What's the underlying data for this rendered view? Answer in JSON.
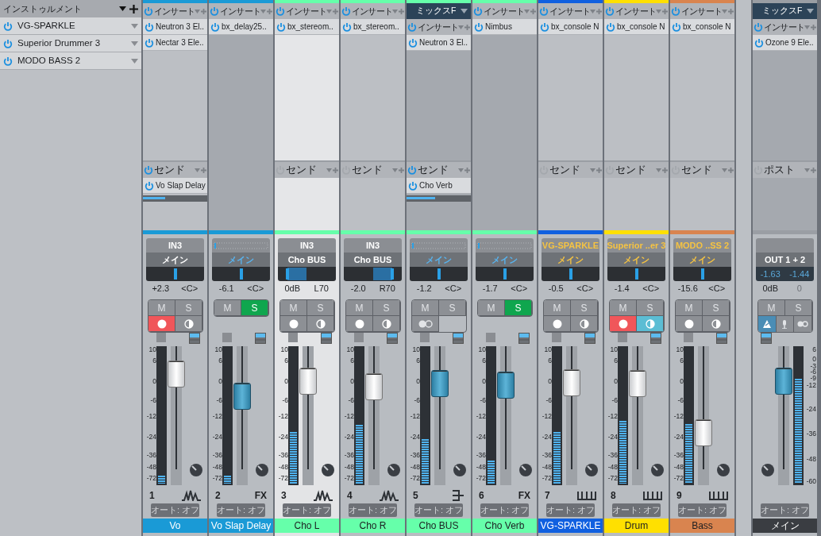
{
  "instruments": {
    "title": "インストゥルメント",
    "items": [
      {
        "name": "VG-SPARKLE",
        "on": true
      },
      {
        "name": "Superior Drummer 3",
        "on": true
      },
      {
        "name": "MODO BASS 2",
        "on": true
      }
    ]
  },
  "channels": [
    {
      "kind": "audio",
      "color": "#1a9ad6",
      "selected": false,
      "inserts": {
        "label": "インサート",
        "on": true,
        "items": [
          {
            "name": "Neutron 3 El..",
            "on": true
          },
          {
            "name": "Nectar 3 Ele..",
            "on": true
          }
        ]
      },
      "sends": {
        "label": "センド",
        "on": true,
        "items": [
          {
            "name": "Vo Slap Delay",
            "on": true,
            "level": 0.35
          }
        ]
      },
      "input": "IN3",
      "output": "メイン",
      "pan": {
        "level": 0.5
      },
      "volume": "+2.3",
      "pan_text": "<C>",
      "mute_label": "M",
      "solo_label": "S",
      "muted": false,
      "solo": false,
      "record": true,
      "monitor": false,
      "fader": {
        "level": 0.8
      },
      "meter": {
        "level": 0.06
      },
      "scale": [
        "10",
        "6",
        "0",
        "-6",
        "-12",
        "-24",
        "-36",
        "-48",
        "-72"
      ],
      "number": "1",
      "auto": "オート: オフ",
      "name": "Vo"
    },
    {
      "kind": "fx",
      "color": "#1a9ad6",
      "selected": false,
      "inserts": {
        "label": "インサート",
        "on": true,
        "items": [
          {
            "name": "bx_delay25..",
            "on": true
          }
        ]
      },
      "output": "メイン",
      "pan": {
        "level": 0.5
      },
      "volume": "-6.1",
      "pan_text": "<C>",
      "mute_label": "M",
      "solo_label": "S",
      "muted": false,
      "solo": true,
      "fader": {
        "level": 0.64
      },
      "meter": {
        "level": 0.06
      },
      "scale": [
        "10",
        "6",
        "0",
        "-6",
        "-12",
        "-24",
        "-36",
        "-48",
        "-72"
      ],
      "number": "2",
      "type_label": "FX",
      "auto": "オート: オフ",
      "name": "Vo Slap Delay"
    },
    {
      "kind": "audio",
      "color": "#66ffaa",
      "selected": true,
      "inserts": {
        "label": "インサート",
        "on": true,
        "items": [
          {
            "name": "bx_stereom..",
            "on": true
          }
        ]
      },
      "sends": {
        "label": "センド",
        "on": false
      },
      "input": "IN3",
      "output": "Cho BUS",
      "pan": {
        "level": 0.17
      },
      "volume": "0dB",
      "pan_text": "L70",
      "mute_label": "M",
      "solo_label": "S",
      "muted": false,
      "solo": false,
      "record": false,
      "monitor": false,
      "fader": {
        "level": 0.75
      },
      "meter": {
        "level": 0.38
      },
      "scale": [
        "10",
        "6",
        "0",
        "-6",
        "-12",
        "-24",
        "-36",
        "-48",
        "-72"
      ],
      "number": "3",
      "auto": "オート: オフ",
      "name": "Cho L"
    },
    {
      "kind": "audio",
      "color": "#66ffaa",
      "selected": false,
      "inserts": {
        "label": "インサート",
        "on": true,
        "items": [
          {
            "name": "bx_stereom..",
            "on": true
          }
        ]
      },
      "sends": {
        "label": "センド",
        "on": false
      },
      "input": "IN3",
      "output": "Cho BUS",
      "pan": {
        "level": 0.83
      },
      "volume": "-2.0",
      "pan_text": "R70",
      "mute_label": "M",
      "solo_label": "S",
      "muted": false,
      "solo": false,
      "record": false,
      "monitor": false,
      "fader": {
        "level": 0.71
      },
      "meter": {
        "level": 0.43
      },
      "scale": [
        "10",
        "6",
        "0",
        "-6",
        "-12",
        "-24",
        "-36",
        "-48",
        "-72"
      ],
      "number": "4",
      "auto": "オート: オフ",
      "name": "Cho R"
    },
    {
      "kind": "bus",
      "color": "#66ffaa",
      "selected": false,
      "header": "ミックスF",
      "inserts": {
        "label": "インサート",
        "on": true,
        "items": [
          {
            "name": "Neutron 3 El..",
            "on": true
          }
        ]
      },
      "sends": {
        "label": "センド",
        "on": true,
        "items": [
          {
            "name": "Cho Verb",
            "on": true,
            "level": 0.45
          }
        ]
      },
      "output": "メイン",
      "pan": {
        "level": 0.5
      },
      "volume": "-1.2",
      "pan_text": "<C>",
      "mute_label": "M",
      "solo_label": "S",
      "muted": false,
      "solo": false,
      "linked": false,
      "fader": {
        "level": 0.73
      },
      "meter": {
        "level": 0.33
      },
      "scale": [
        "10",
        "6",
        "0",
        "-6",
        "-12",
        "-24",
        "-36",
        "-48",
        "-72"
      ],
      "number": "5",
      "auto": "オート: オフ",
      "name": "Cho BUS"
    },
    {
      "kind": "fx",
      "color": "#66ffaa",
      "selected": false,
      "inserts": {
        "label": "インサート",
        "on": true,
        "items": [
          {
            "name": "Nimbus",
            "on": true
          }
        ]
      },
      "output": "メイン",
      "pan": {
        "level": 0.5
      },
      "volume": "-1.7",
      "pan_text": "<C>",
      "mute_label": "M",
      "solo_label": "S",
      "muted": false,
      "solo": true,
      "fader": {
        "level": 0.72
      },
      "meter": {
        "level": 0.17
      },
      "scale": [
        "10",
        "6",
        "0",
        "-6",
        "-12",
        "-24",
        "-36",
        "-48",
        "-72"
      ],
      "number": "6",
      "type_label": "FX",
      "auto": "オート: オフ",
      "name": "Cho Verb"
    },
    {
      "kind": "instrument",
      "color": "#1060e0",
      "selected": false,
      "inserts": {
        "label": "インサート",
        "on": true,
        "items": [
          {
            "name": "bx_console N",
            "on": true
          }
        ]
      },
      "sends": {
        "label": "センド",
        "on": false
      },
      "input": "VG-SPARKLE",
      "output": "メイン",
      "pan": {
        "level": 0.5
      },
      "volume": "-0.5",
      "pan_text": "<C>",
      "mute_label": "M",
      "solo_label": "S",
      "muted": false,
      "solo": false,
      "record": false,
      "monitor": false,
      "fader": {
        "level": 0.74
      },
      "meter": {
        "level": 0.38
      },
      "scale": [
        "10",
        "6",
        "0",
        "-6",
        "-12",
        "-24",
        "-36",
        "-48",
        "-72"
      ],
      "number": "7",
      "auto": "オート: オフ",
      "name": "VG-SPARKLE"
    },
    {
      "kind": "instrument",
      "color": "#ffe000",
      "selected": false,
      "inserts": {
        "label": "インサート",
        "on": true,
        "items": [
          {
            "name": "bx_console N",
            "on": true
          }
        ]
      },
      "sends": {
        "label": "センド",
        "on": false
      },
      "input": "Superior ..er 3",
      "output": "メイン",
      "pan": {
        "level": 0.5
      },
      "volume": "-1.4",
      "pan_text": "<C>",
      "mute_label": "M",
      "solo_label": "S",
      "muted": false,
      "solo": false,
      "record": true,
      "monitor": true,
      "fader": {
        "level": 0.73
      },
      "meter": {
        "level": 0.46
      },
      "scale": [
        "10",
        "6",
        "0",
        "-6",
        "-12",
        "-24",
        "-36",
        "-48",
        "-72"
      ],
      "number": "8",
      "auto": "オート: オフ",
      "name": "Drum"
    },
    {
      "kind": "instrument",
      "color": "#d9844f",
      "selected": false,
      "inserts": {
        "label": "インサート",
        "on": true,
        "items": [
          {
            "name": "bx_console N",
            "on": true
          }
        ]
      },
      "sends": {
        "label": "センド",
        "on": false
      },
      "input": "MODO ..SS 2",
      "output": "メイン",
      "pan": {
        "level": 0.5
      },
      "volume": "-15.6",
      "pan_text": "<C>",
      "mute_label": "M",
      "solo_label": "S",
      "muted": false,
      "solo": false,
      "record": false,
      "monitor": false,
      "fader": {
        "level": 0.38
      },
      "meter": {
        "level": 0.44
      },
      "scale": [
        "10",
        "6",
        "0",
        "-6",
        "-12",
        "-24",
        "-36",
        "-48",
        "-72"
      ],
      "number": "9",
      "auto": "オート: オフ",
      "name": "Bass"
    }
  ],
  "main": {
    "header": "ミックスF",
    "inserts": {
      "label": "インサート",
      "on": true,
      "items": [
        {
          "name": "Ozone 9 Ele..",
          "on": true
        }
      ]
    },
    "post": {
      "label": "ポスト",
      "on": false
    },
    "output": "OUT 1 + 2",
    "readings": [
      "-1.63",
      "-1.44"
    ],
    "volume": "0dB",
    "pan_text": "0",
    "pan_disabled": true,
    "mute_label": "M",
    "solo_label": "S",
    "muted": false,
    "solo": false,
    "buttons": [
      {
        "kind": "dim",
        "on": true
      },
      {
        "kind": "mic",
        "on": false
      },
      {
        "kind": "link",
        "on": false
      }
    ],
    "fader": {
      "level": 0.75
    },
    "meter": {
      "level": 0.77
    },
    "scale": [
      "6",
      "0",
      "-3",
      "-6",
      "-9",
      "-12",
      "-24",
      "-36",
      "-48",
      "-60"
    ],
    "auto": "オート: オフ",
    "name": "メイン"
  }
}
